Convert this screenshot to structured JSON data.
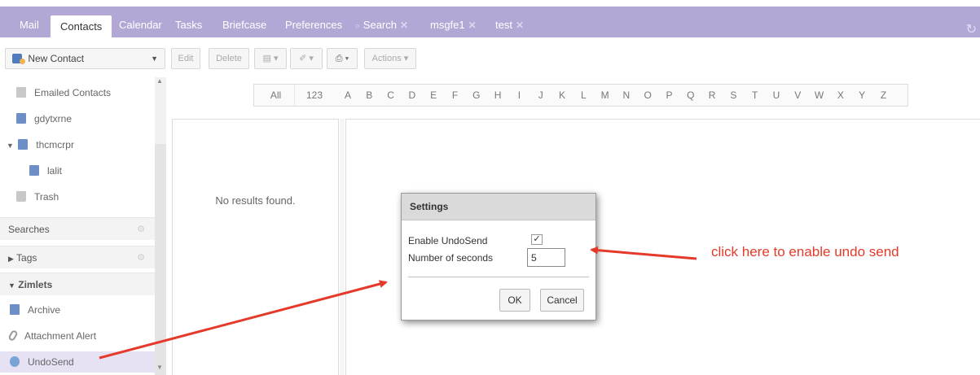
{
  "tabs": {
    "mail": "Mail",
    "contacts": "Contacts",
    "calendar": "Calendar",
    "tasks": "Tasks",
    "briefcase": "Briefcase",
    "preferences": "Preferences",
    "search": "Search",
    "msgfe1": "msgfe1",
    "test": "test"
  },
  "toolbar": {
    "new_contact": "New Contact",
    "edit": "Edit",
    "delete": "Delete",
    "actions": "Actions"
  },
  "sidebar": {
    "items": [
      {
        "label": "Emailed Contacts"
      },
      {
        "label": "gdytxrne"
      },
      {
        "label": "thcmcrpr"
      },
      {
        "label": "lalit"
      },
      {
        "label": "Trash"
      }
    ],
    "searches": "Searches",
    "tags": "Tags",
    "zimlets": "Zimlets",
    "zimlet_items": [
      {
        "label": "Archive"
      },
      {
        "label": "Attachment Alert"
      },
      {
        "label": "UndoSend"
      }
    ]
  },
  "alphabet": {
    "all": "All",
    "num": "123",
    "letters": [
      "A",
      "B",
      "C",
      "D",
      "E",
      "F",
      "G",
      "H",
      "I",
      "J",
      "K",
      "L",
      "M",
      "N",
      "O",
      "P",
      "Q",
      "R",
      "S",
      "T",
      "U",
      "V",
      "W",
      "X",
      "Y",
      "Z"
    ]
  },
  "list": {
    "empty": "No results found."
  },
  "dialog": {
    "title": "Settings",
    "enable_label": "Enable UndoSend",
    "enabled": true,
    "seconds_label": "Number of seconds",
    "seconds_value": "5",
    "ok": "OK",
    "cancel": "Cancel"
  },
  "annotation": {
    "text": "click here to enable undo send",
    "color": "#e53a2a"
  },
  "colors": {
    "appbar": "#b3a8d5"
  }
}
